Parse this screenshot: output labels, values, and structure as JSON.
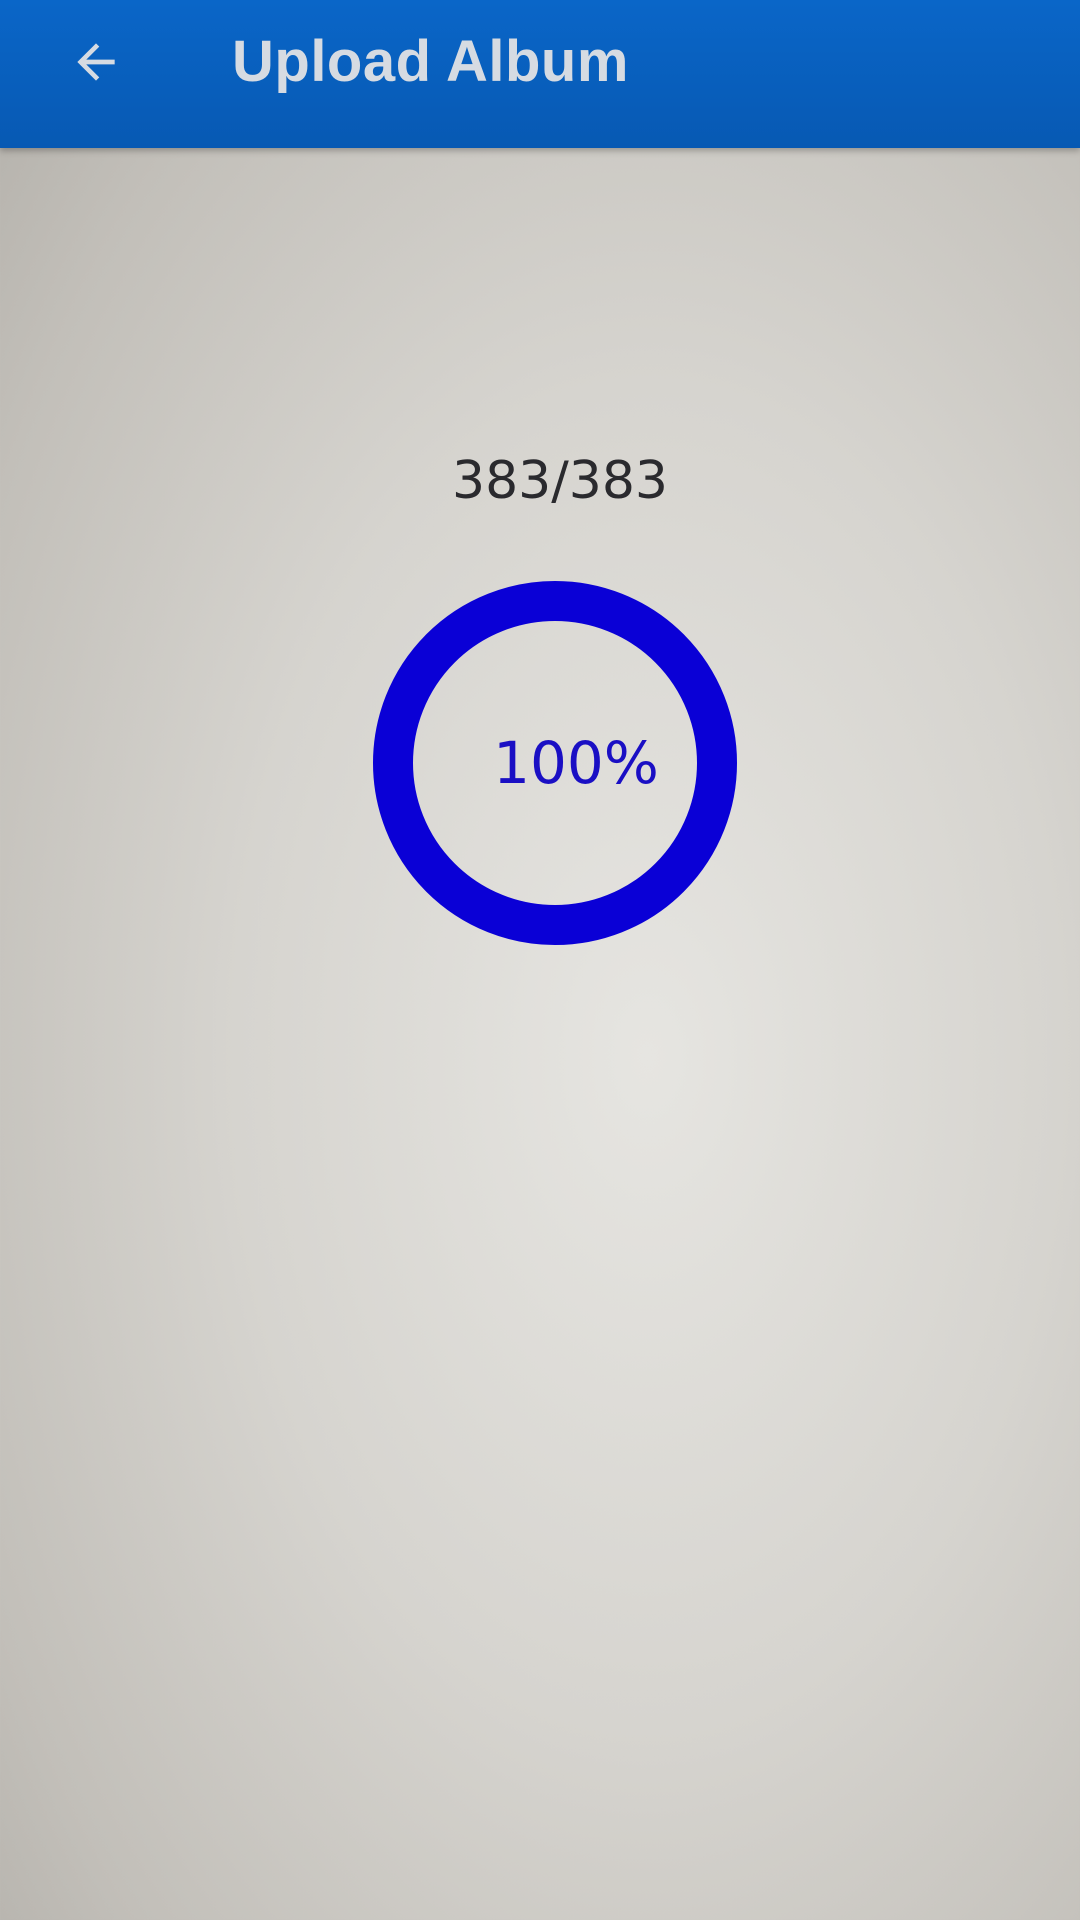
{
  "app_bar": {
    "title": "Upload Album",
    "back_icon": "arrow-left-icon",
    "background": "#0a66c8",
    "title_color": "#d6dbe2"
  },
  "upload": {
    "count_text": "383/383",
    "uploaded": 383,
    "total": 383,
    "progress_text": "100%",
    "progress": 1.0,
    "ring_color": "#0a00d6"
  }
}
